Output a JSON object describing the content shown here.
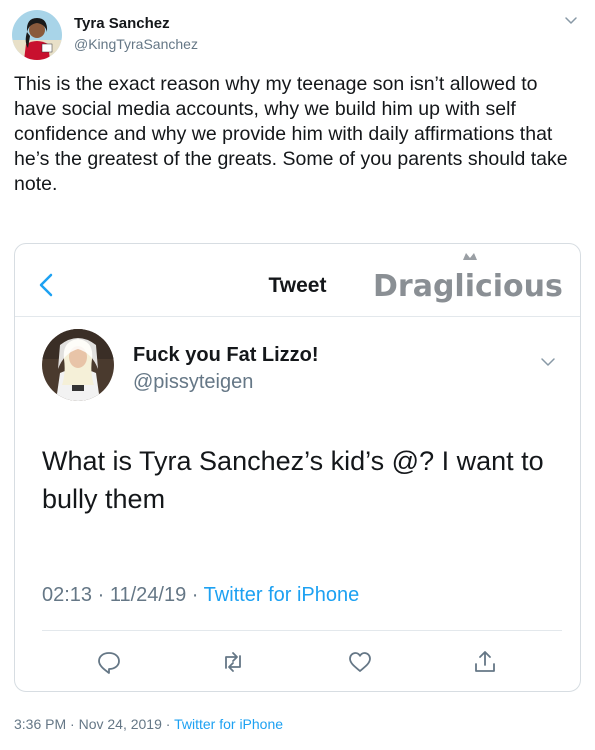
{
  "outer_tweet": {
    "author_name": "Tyra Sanchez",
    "author_handle": "@KingTyraSanchez",
    "text": "This is the exact reason why my teenage son isn’t allowed to have social media accounts, why we build him up with self confidence and why we provide him with daily affirmations that he’s the greatest of the greats. Some of you parents should take note.",
    "time": "3:36 PM",
    "date": "Nov 24, 2019",
    "source": "Twitter for iPhone"
  },
  "embedded_screenshot": {
    "nav_title": "Tweet",
    "watermark": "Draglicious",
    "author_name": "Fuck you Fat Lizzo!",
    "author_handle": "@pissyteigen",
    "text": "What is Tyra Sanchez’s kid’s @? I want to bully them",
    "time": "02:13",
    "date": "11/24/19",
    "source": "Twitter for iPhone",
    "actions": [
      "reply-icon",
      "retweet-icon",
      "like-icon",
      "share-icon"
    ]
  },
  "separator": " · ",
  "colors": {
    "link_blue": "#1da1f2",
    "secondary_gray": "#657786",
    "text_dark": "#14171a",
    "border": "#d7dde2"
  }
}
